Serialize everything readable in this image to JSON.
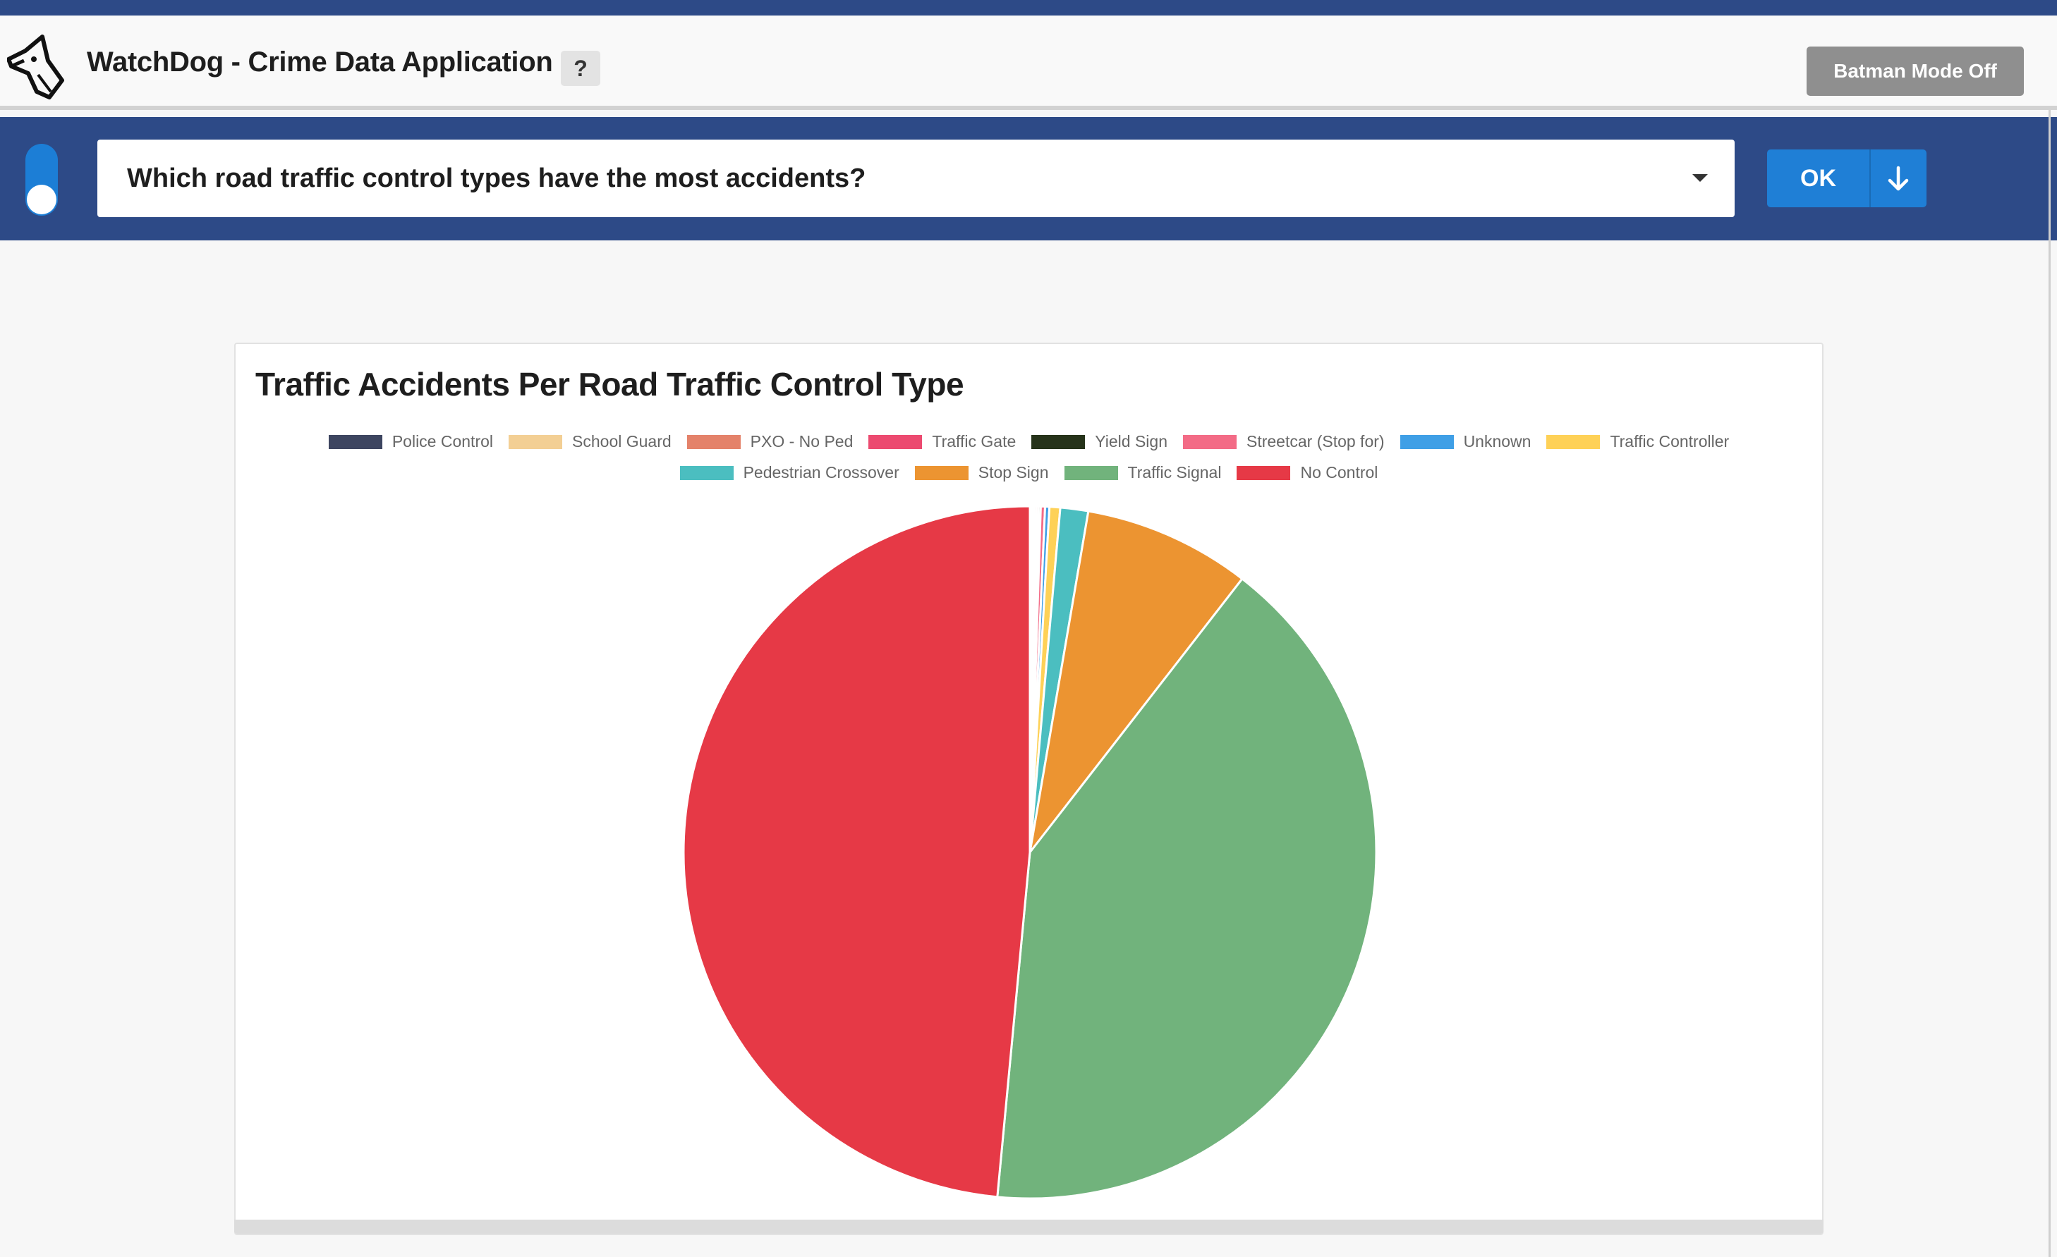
{
  "app": {
    "title": "WatchDog - Crime Data Application",
    "help_label": "?",
    "batman_label": "Batman Mode Off"
  },
  "query": {
    "text": "Which road traffic control types have the most accidents?",
    "ok_label": "OK"
  },
  "colors": {
    "brand_blue": "#2d4a87",
    "accent_blue": "#1f7fd6"
  },
  "chart_data": {
    "type": "pie",
    "title": "Traffic Accidents Per Road Traffic Control Type",
    "legend_position": "top-center",
    "categories": [
      "Police Control",
      "School Guard",
      "PXO - No Ped",
      "Traffic Gate",
      "Yield Sign",
      "Streetcar (Stop for)",
      "Unknown",
      "Traffic Controller",
      "Pedestrian Crossover",
      "Stop Sign",
      "Traffic Signal",
      "No Control"
    ],
    "values": [
      0.1,
      0.1,
      0.1,
      0.1,
      0.1,
      0.2,
      0.2,
      0.5,
      1.3,
      7.8,
      41.0,
      48.5
    ],
    "colors": [
      "#3d4560",
      "#f3cf94",
      "#e4826a",
      "#ec4a70",
      "#26331a",
      "#f36b86",
      "#3f9fe6",
      "#fed157",
      "#4bbec0",
      "#ec9431",
      "#71b37c",
      "#e63946"
    ]
  }
}
